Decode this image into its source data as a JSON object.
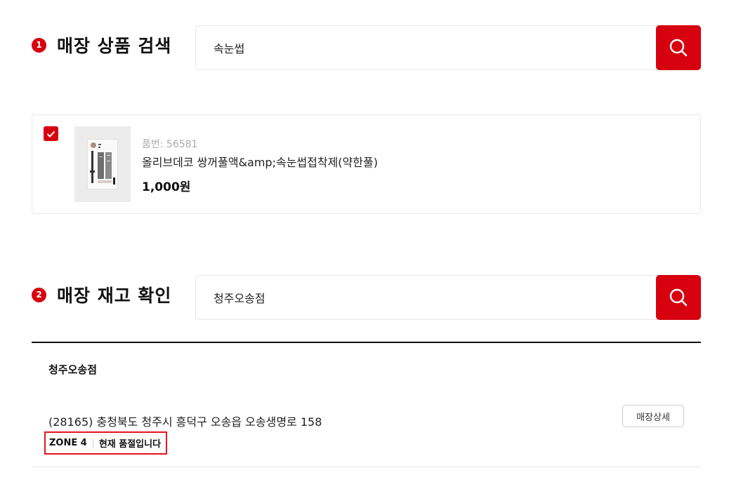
{
  "section1": {
    "step": "1",
    "title": "매장 상품 검색",
    "search_value": "속눈썹",
    "search_button_icon": "search-icon"
  },
  "product": {
    "checked": true,
    "code": "품번: 56581",
    "name": "올리브데코 쌍꺼풀액&amp;속눈썹접착제(약한풀)",
    "price": "1,000원"
  },
  "section2": {
    "step": "2",
    "title": "매장 재고 확인",
    "search_value": "청주오송점",
    "search_button_icon": "search-icon"
  },
  "store": {
    "name": "청주오송점",
    "address": "(28165) 충청북도 청주시 흥덕구 오송읍 오송생명로 158",
    "detail_button": "매장상세",
    "zone": "ZONE 4",
    "stock_status": "현재 품절입니다"
  },
  "colors": {
    "accent": "#d7000f",
    "highlight_border": "#e8121f"
  }
}
